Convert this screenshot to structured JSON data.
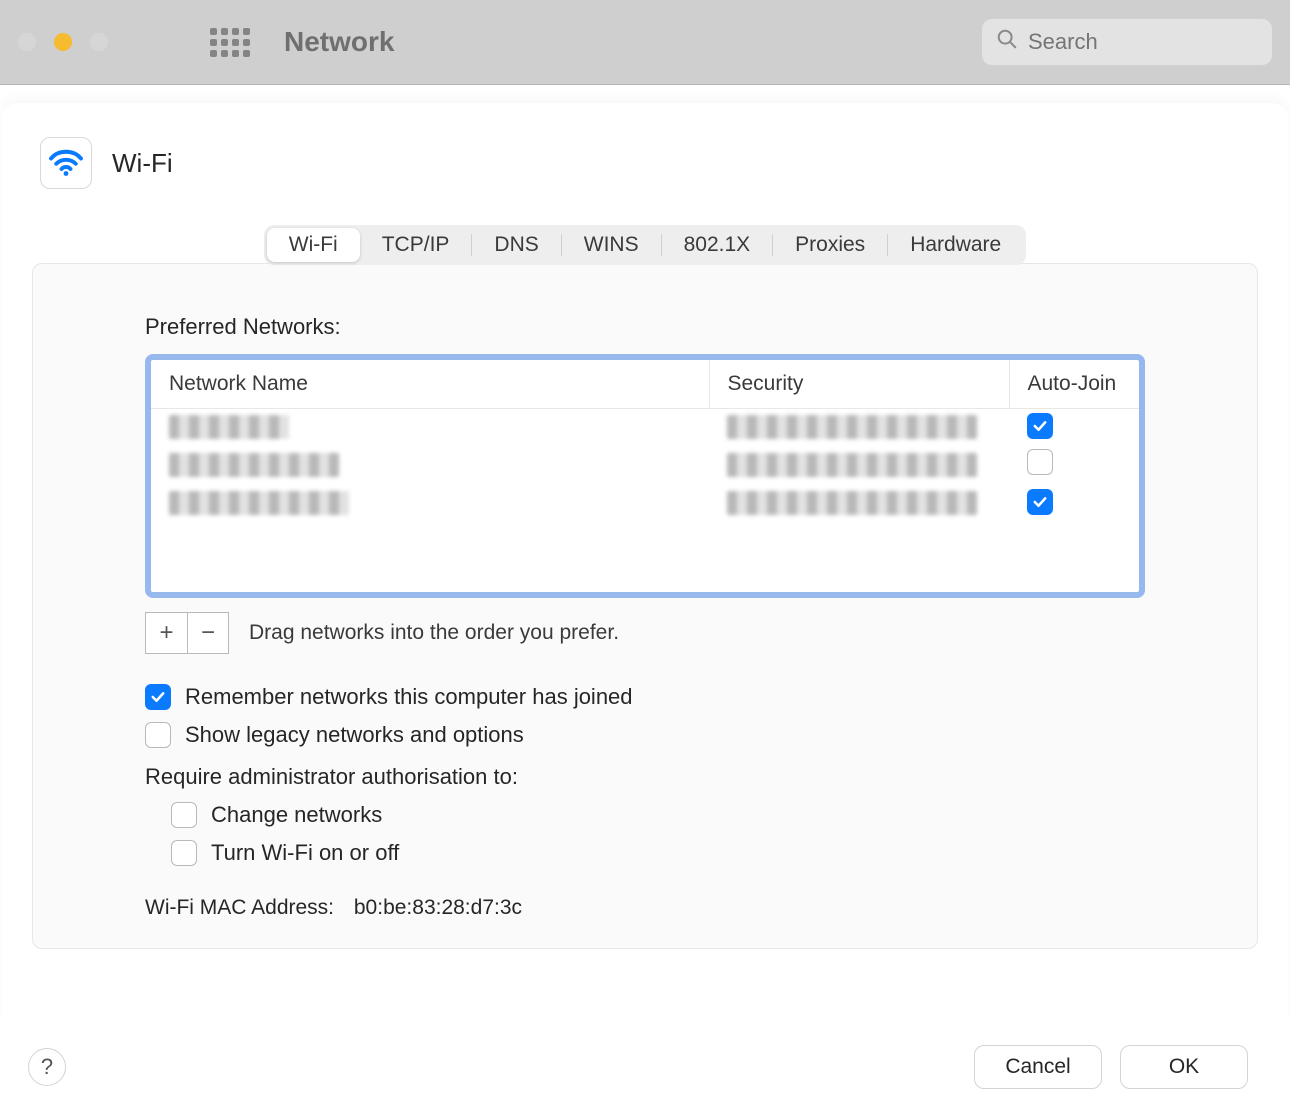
{
  "window": {
    "title": "Network"
  },
  "search": {
    "placeholder": "Search"
  },
  "sheet": {
    "title": "Wi-Fi",
    "tabs": [
      "Wi-Fi",
      "TCP/IP",
      "DNS",
      "WINS",
      "802.1X",
      "Proxies",
      "Hardware"
    ],
    "selected_tab_index": 0,
    "preferred_networks_label": "Preferred Networks:",
    "columns": {
      "name": "Network Name",
      "security": "Security",
      "autojoin": "Auto-Join"
    },
    "networks": [
      {
        "name_redacted": true,
        "security_redacted": true,
        "auto_join": true
      },
      {
        "name_redacted": true,
        "security_redacted": true,
        "auto_join": false
      },
      {
        "name_redacted": true,
        "security_redacted": true,
        "auto_join": true
      }
    ],
    "drag_hint": "Drag networks into the order you prefer.",
    "options": {
      "remember": {
        "label": "Remember networks this computer has joined",
        "checked": true
      },
      "show_legacy": {
        "label": "Show legacy networks and options",
        "checked": false
      },
      "require_auth_label": "Require administrator authorisation to:",
      "auth_change_networks": {
        "label": "Change networks",
        "checked": false
      },
      "auth_toggle_wifi": {
        "label": "Turn Wi-Fi on or off",
        "checked": false
      }
    },
    "mac_address": {
      "label": "Wi-Fi MAC Address:",
      "value": "b0:be:83:28:d7:3c"
    }
  },
  "footer": {
    "cancel": "Cancel",
    "ok": "OK",
    "help": "?"
  }
}
